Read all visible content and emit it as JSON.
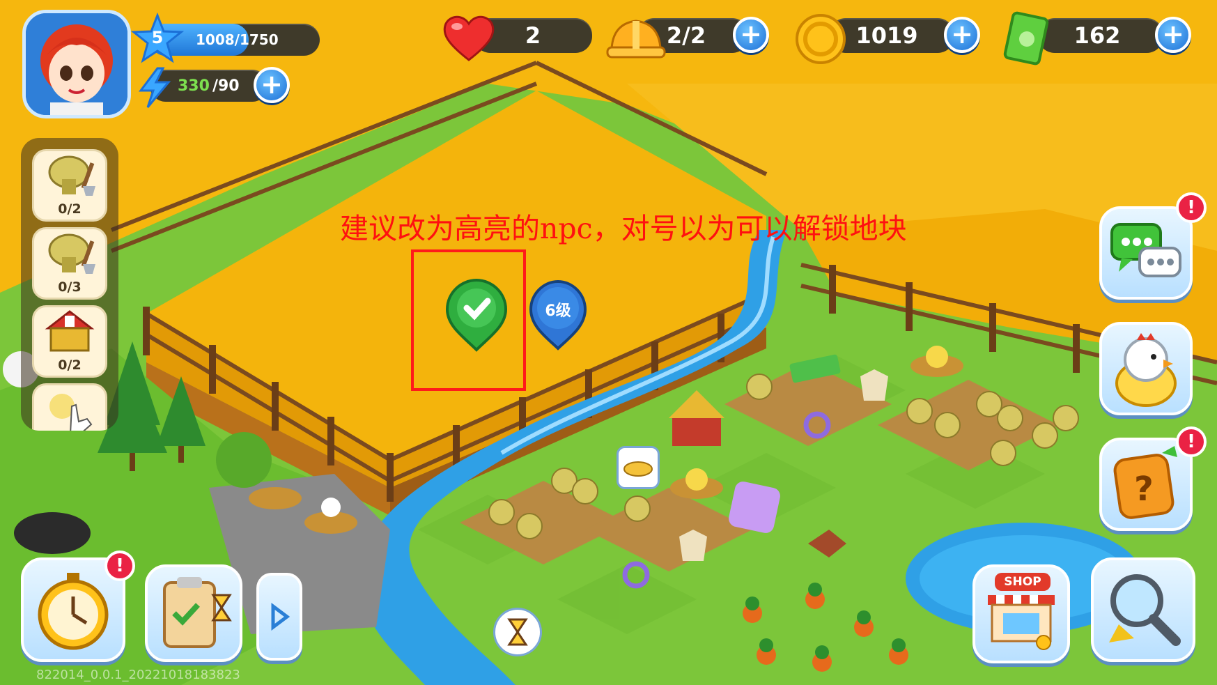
{
  "player": {
    "level": "5",
    "xp": "1008/1750",
    "energy_current": "330",
    "energy_max": "/90"
  },
  "resources": {
    "hearts": "2",
    "builders": "2/2",
    "coins": "1019",
    "cash": "162"
  },
  "plus_label": "+",
  "quests": [
    {
      "count": "0/2",
      "icon": "wheat-shovel-icon"
    },
    {
      "count": "0/3",
      "icon": "wheat-shovel-icon"
    },
    {
      "count": "0/2",
      "icon": "barn-icon"
    },
    {
      "count": "",
      "icon": "hand-tap-icon"
    }
  ],
  "right_buttons": [
    {
      "icon": "chat-icon",
      "badge": "!"
    },
    {
      "icon": "chick-egg-icon",
      "badge": ""
    },
    {
      "icon": "mystery-box-icon",
      "badge": "!"
    }
  ],
  "bottom_buttons": {
    "timer_badge": "!",
    "shop_label": "SHOP"
  },
  "map": {
    "unlock_pin_label": "6级"
  },
  "annotation": {
    "text": "建议改为高亮的npc，对号以为可以解锁地块"
  },
  "version": "822014_0.0.1_20221018183823",
  "colors": {
    "wheat": "#f6b70e",
    "grass": "#7cc63a",
    "water": "#2fa0e6",
    "accent_blue": "#1b6fd6",
    "annotation_red": "#ff1010"
  }
}
